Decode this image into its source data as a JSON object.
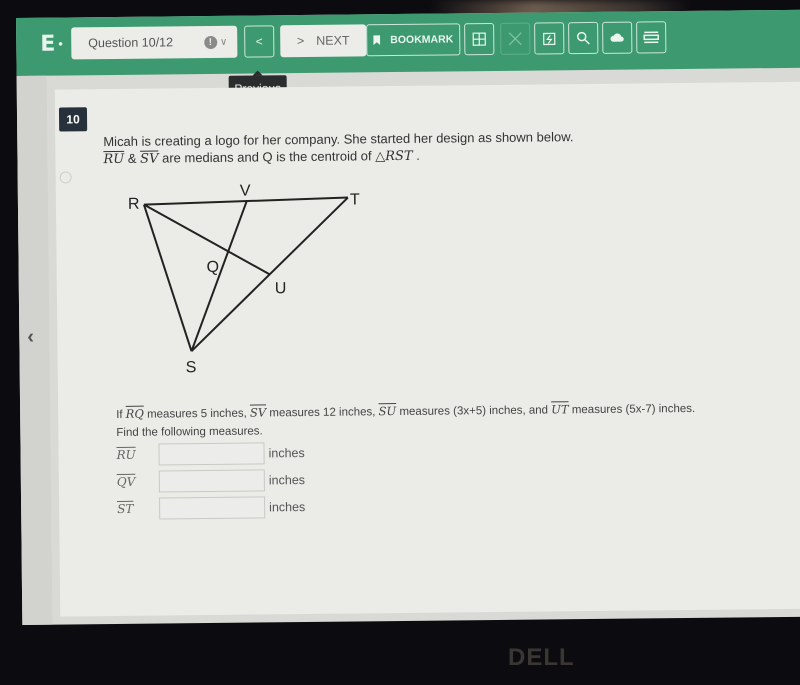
{
  "toolbar": {
    "logo": "E",
    "question_selector": "Question 10/12",
    "prev_label": "<",
    "next_label": "NEXT",
    "next_chevron": ">",
    "bookmark_label": "BOOKMARK",
    "tooltip": "Previous",
    "icons": [
      "grid-icon",
      "close-icon",
      "calculator-icon",
      "search-icon",
      "cloud-icon",
      "menu-icon"
    ]
  },
  "question": {
    "number": "10",
    "prompt_line1": "Micah is creating a logo for her company. She started her design as shown below.",
    "prompt_seg1": "RU",
    "prompt_amp": " & ",
    "prompt_seg2": "SV",
    "prompt_rest": " are medians and Q is the centroid of ",
    "prompt_triangle": "△RST",
    "prompt_end": " .",
    "diagram_labels": {
      "R": "R",
      "V": "V",
      "T": "T",
      "Q": "Q",
      "U": "U",
      "S": "S"
    },
    "given": {
      "p1": "If ",
      "s1": "RQ",
      "p2": " measures 5 inches, ",
      "s2": "SV",
      "p3": " measures 12 inches, ",
      "s3": "SU",
      "p4": " measures (3x+5) inches, and ",
      "s4": "UT",
      "p5": " measures (5x-7) inches."
    },
    "instruction": "Find the following measures.",
    "answers": [
      {
        "segment": "RU",
        "value": "",
        "unit": "inches"
      },
      {
        "segment": "QV",
        "value": "",
        "unit": "inches"
      },
      {
        "segment": "ST",
        "value": "",
        "unit": "inches"
      }
    ]
  },
  "bezel": {
    "brand": "DELL"
  }
}
